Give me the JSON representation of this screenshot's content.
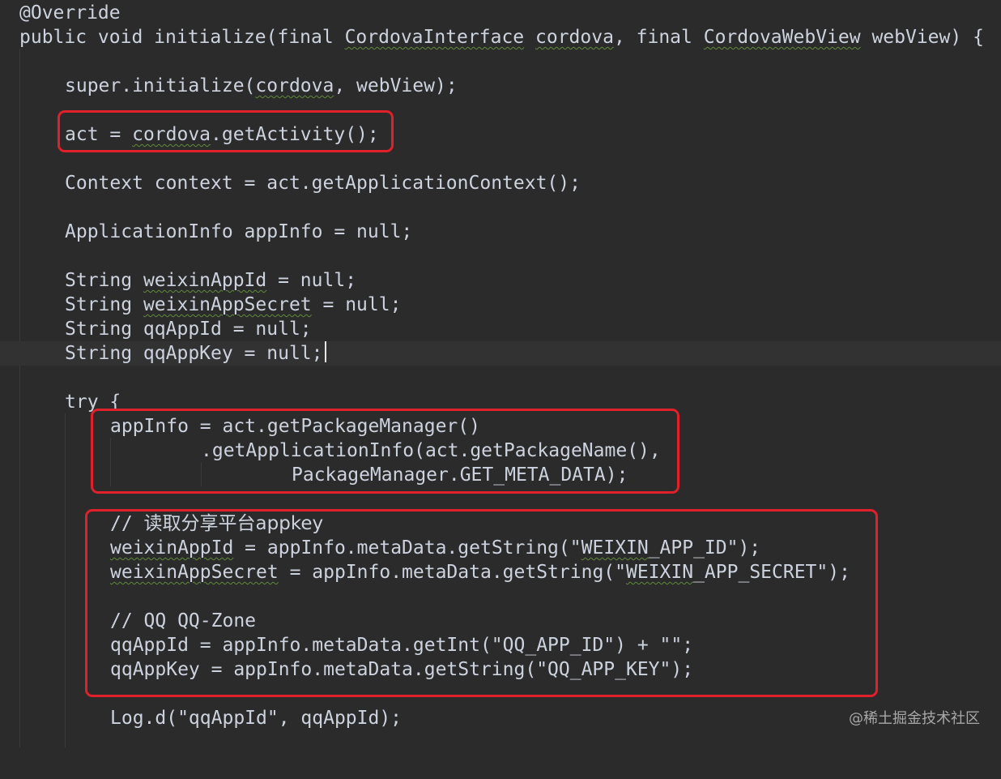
{
  "editor": {
    "lines": [
      {
        "text": "@Override"
      },
      {
        "segments": [
          "public void initialize(final ",
          "CordovaInterface",
          " ",
          "cordova",
          ", final ",
          "CordovaWebView",
          " webView) {"
        ]
      },
      {
        "segments": [
          "super.initialize(",
          "cordova",
          ", webView);"
        ]
      },
      {
        "segments": [
          "act = ",
          "cordova",
          ".getActivity();"
        ]
      },
      {
        "text": "Context context = act.getApplicationContext();"
      },
      {
        "text": "ApplicationInfo appInfo = null;"
      },
      {
        "segments": [
          "String ",
          "weixinAppId",
          " = null;"
        ]
      },
      {
        "segments": [
          "String ",
          "weixinAppSecret",
          " = null;"
        ]
      },
      {
        "text": "String qqAppId = null;"
      },
      {
        "text": "String qqAppKey = null;"
      },
      {
        "text": "try {"
      },
      {
        "text": "appInfo = act.getPackageManager()"
      },
      {
        "text": ".getApplicationInfo(act.getPackageName(),"
      },
      {
        "text": "PackageManager.GET_META_DATA);"
      },
      {
        "segments": [
          "// ",
          "读取分享平台appkey"
        ]
      },
      {
        "segments": [
          "weixinAppId",
          " = appInfo.metaData.getString(\"",
          "WEIXIN",
          "_APP_ID\");"
        ]
      },
      {
        "segments": [
          "weixinAppSecret",
          " = appInfo.metaData.getString(\"",
          "WEIXIN",
          "_APP_SECRET\");"
        ]
      },
      {
        "text": "// QQ QQ-Zone"
      },
      {
        "text": "qqAppId = appInfo.metaData.getInt(\"QQ_APP_ID\") + \"\";"
      },
      {
        "text": "qqAppKey = appInfo.metaData.getString(\"QQ_APP_KEY\");"
      },
      {
        "text": "Log.d(\"qqAppId\", qqAppId);"
      }
    ]
  },
  "colors": {
    "background": "#2b2b2b",
    "text": "#cdd3de",
    "highlight_box": "#e0202b",
    "spellcheck_squiggle": "#5f8a3b"
  },
  "watermark": "@稀土掘金技术社区"
}
